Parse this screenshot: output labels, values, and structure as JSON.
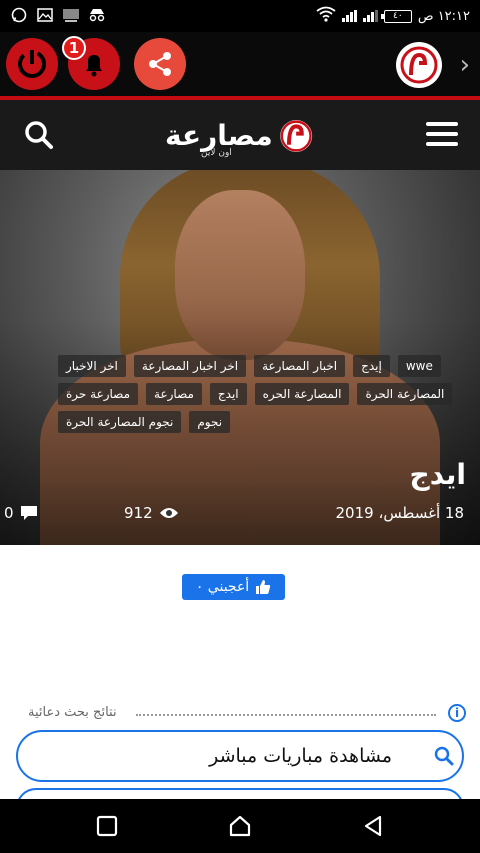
{
  "status_bar": {
    "time": "١٢:١٢ ص",
    "battery": "٤٠",
    "icons": [
      "whatsapp-icon",
      "image-icon",
      "cast-icon",
      "incognito-icon",
      "wifi-icon",
      "signal-icon"
    ]
  },
  "toolbar": {
    "notification_count": "1",
    "buttons": [
      "power-button",
      "notification-button",
      "share-button"
    ]
  },
  "site": {
    "logo_text": "مصارعة",
    "logo_sub": "اون لاين"
  },
  "article": {
    "tags": [
      "wwe",
      "إيدج",
      "اخبار المصارعة",
      "اخر اخبار المصارعة",
      "اخر الاخبار",
      "المصارعة الحرة",
      "المصارعة الحره",
      "ايدج",
      "مصارعة",
      "مصارعة حرة",
      "نجوم",
      "نجوم المصارعة الحرة"
    ],
    "title": "ايدج",
    "date": "18 أغسطس، 2019",
    "views": "912",
    "comments": "0",
    "like_label": "أعجبني ٠"
  },
  "ads": {
    "label": "نتائج بحث دعائية",
    "query": "مشاهدة مباريات مباشر"
  },
  "colors": {
    "accent_red": "#c81018",
    "link_blue": "#1a73e8"
  }
}
